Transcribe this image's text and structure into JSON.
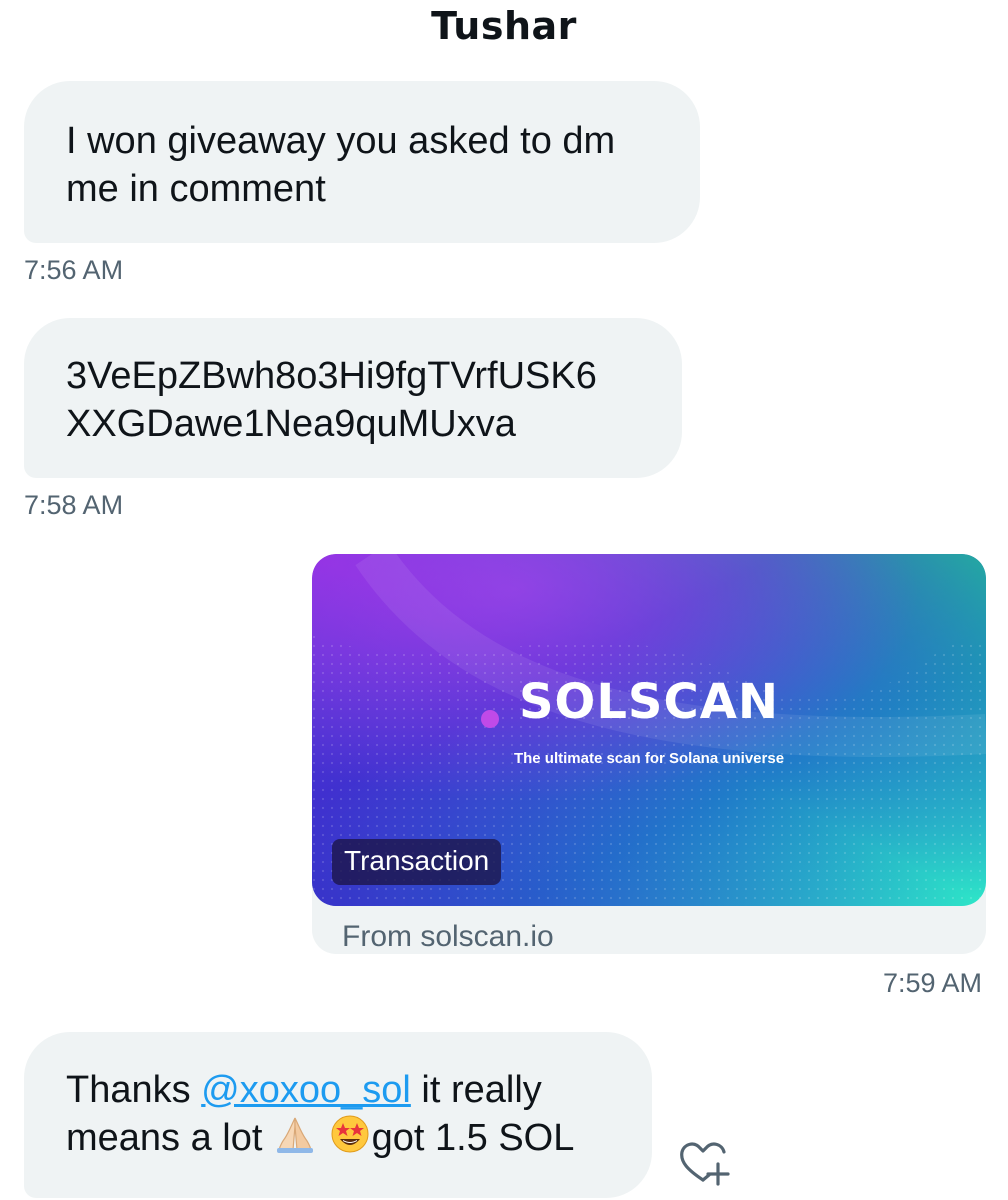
{
  "header": {
    "title": "Tushar"
  },
  "messages": [
    {
      "text": "I won giveaway you asked to dm me in comment",
      "time": "7:56 AM"
    },
    {
      "line1": "3VeEpZBwh8o3Hi9fgTVrfUSK6",
      "line2": "XXGDawe1Nea9quMUxva",
      "time": "7:58 AM"
    }
  ],
  "link_card": {
    "brand": "SOLSCAN",
    "tagline": "The ultimate scan for Solana universe",
    "badge": "Transaction",
    "source": "From solscan.io",
    "time": "7:59 AM"
  },
  "last_message": {
    "part1": "Thanks ",
    "mention": "@xoxoo_sol",
    "part2": " it really means a lot ",
    "part3": "got 1.5 SOL"
  },
  "icons": [
    "praying-hands-emoji",
    "star-struck-emoji",
    "add-reaction-icon"
  ],
  "colors": {
    "bubble": "#eff3f4",
    "link": "#1d9bf0",
    "muted": "#536471"
  }
}
